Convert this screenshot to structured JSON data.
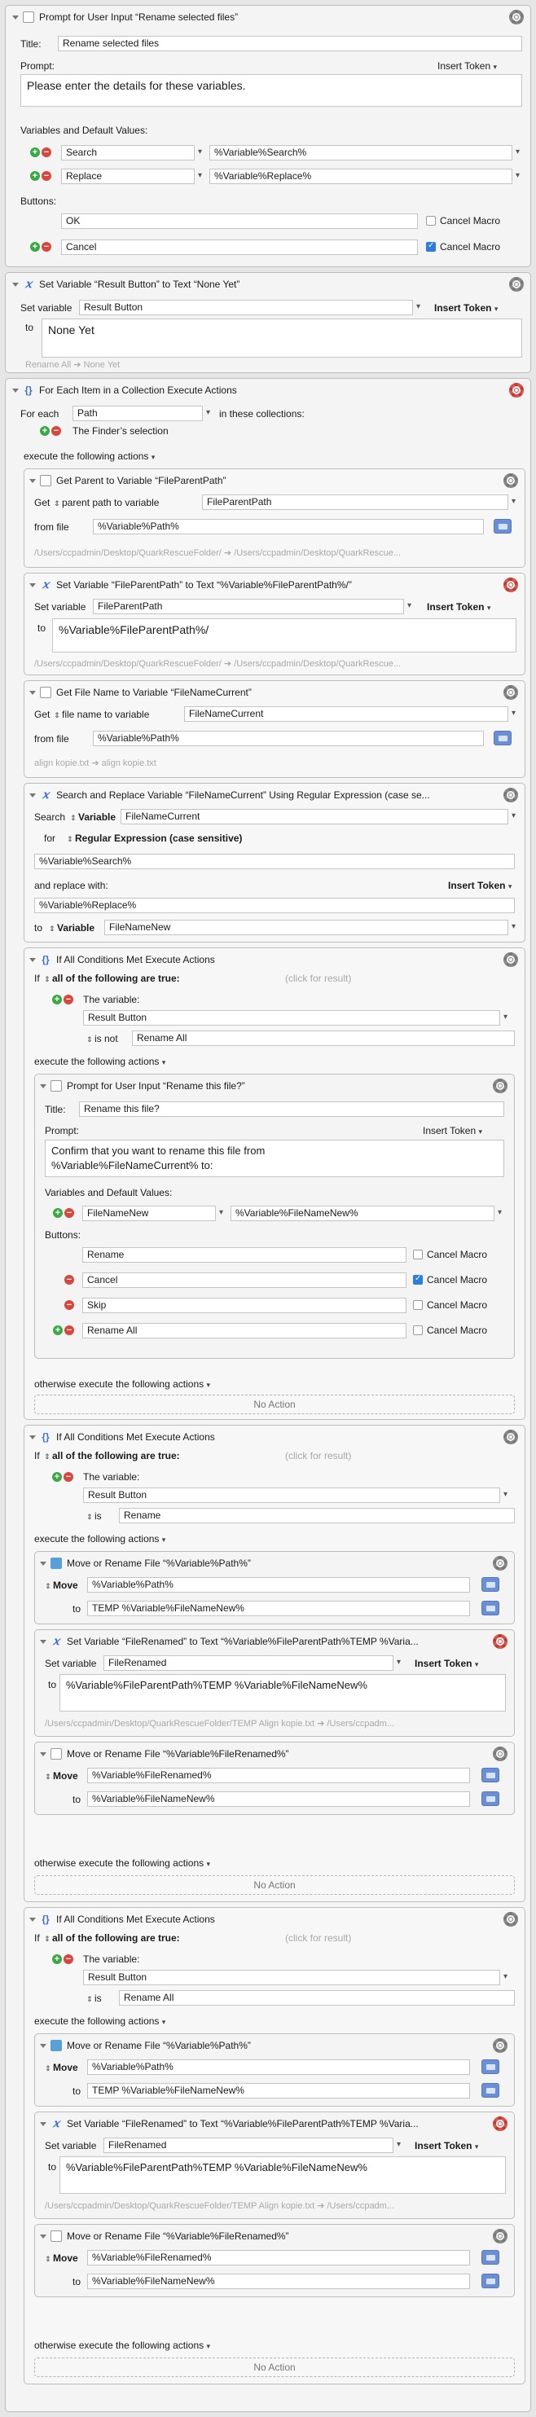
{
  "prompt1": {
    "title": "Prompt for User Input “Rename selected files”",
    "title_label": "Title:",
    "title_value": "Rename selected files",
    "prompt_label": "Prompt:",
    "insert_token": "Insert Token",
    "prompt_text": [
      "Please enter the details for these variables."
    ],
    "vars_label": "Variables and Default Values:",
    "vars": [
      {
        "name": "Search",
        "value": "%Variable%Search%"
      },
      {
        "name": "Replace",
        "value": "%Variable%Replace%"
      }
    ],
    "buttons_label": "Buttons:",
    "buttons": [
      {
        "label": "OK",
        "cancel": false
      },
      {
        "label": "Cancel",
        "cancel": true
      }
    ],
    "cancel_macro": "Cancel Macro"
  },
  "setvar1": {
    "title": "Set Variable “Result Button” to Text “None Yet”",
    "set_variable_label": "Set variable",
    "var_name": "Result Button",
    "insert_token": "Insert Token",
    "to_label": "to",
    "text": "None Yet",
    "path": "Rename All ➔ None Yet"
  },
  "foreach": {
    "title": "For Each Item in a Collection Execute Actions",
    "for_each_label": "For each",
    "for_each_var": "Path",
    "collections_label": "in these collections:",
    "collection": "The Finder’s selection",
    "execute_label": "execute the following actions"
  },
  "getparent": {
    "title": "Get Parent to Variable “FileParentPath”",
    "get_label": "Get",
    "mode": "parent path to variable",
    "var": "FileParentPath",
    "from_label": "from file",
    "from_value": "%Variable%Path%",
    "path": "/Users/ccpadmin/Desktop/QuarkRescueFolder/ ➔ /Users/ccpadmin/Desktop/QuarkRescue..."
  },
  "setvar2": {
    "title": "Set Variable “FileParentPath” to Text “%Variable%FileParentPath%/”",
    "set_variable_label": "Set variable",
    "var_name": "FileParentPath",
    "insert_token": "Insert Token",
    "to_label": "to",
    "text": "%Variable%FileParentPath%/",
    "path": "/Users/ccpadmin/Desktop/QuarkRescueFolder/ ➔ /Users/ccpadmin/Desktop/QuarkRescue..."
  },
  "getname": {
    "title": "Get File Name to Variable “FileNameCurrent”",
    "get_label": "Get",
    "mode": "file name to variable",
    "var": "FileNameCurrent",
    "from_label": "from file",
    "from_value": "%Variable%Path%",
    "path": "align kopie.txt ➔ align kopie.txt"
  },
  "searchreplace": {
    "title": "Search and Replace Variable “FileNameCurrent” Using Regular Expression (case se...",
    "search_label": "Search",
    "variable_label": "Variable",
    "var": "FileNameCurrent",
    "for_label": "for",
    "mode": "Regular Expression (case sensitive)",
    "search_value": "%Variable%Search%",
    "replace_label": "and replace with:",
    "insert_token": "Insert Token",
    "replace_value": "%Variable%Replace%",
    "to_label": "to",
    "to_var_label": "Variable",
    "to_var": "FileNameNew"
  },
  "if1": {
    "title": "If All Conditions Met Execute Actions",
    "if_label": "If",
    "all_label": "all of the following are true:",
    "click_result": "(click for result)",
    "the_variable": "The variable:",
    "var": "Result Button",
    "cond": "is not",
    "cond_value": "Rename All",
    "execute_label": "execute the following actions",
    "otherwise_label": "otherwise execute the following actions",
    "no_action": "No Action"
  },
  "prompt2": {
    "title": "Prompt for User Input “Rename this file?”",
    "title_label": "Title:",
    "title_value": "Rename this file?",
    "prompt_label": "Prompt:",
    "insert_token": "Insert Token",
    "prompt_text": [
      "Confirm that you want to rename this file from",
      "%Variable%FileNameCurrent% to:"
    ],
    "vars_label": "Variables and Default Values:",
    "vars": [
      {
        "name": "FileNameNew",
        "value": "%Variable%FileNameNew%"
      }
    ],
    "buttons_label": "Buttons:",
    "buttons": [
      {
        "label": "Rename",
        "cancel": false
      },
      {
        "label": "Cancel",
        "cancel": true
      },
      {
        "label": "Skip",
        "cancel": false
      },
      {
        "label": "Rename All",
        "cancel": false
      }
    ],
    "cancel_macro": "Cancel Macro"
  },
  "if2": {
    "title": "If All Conditions Met Execute Actions",
    "if_label": "If",
    "all_label": "all of the following are true:",
    "click_result": "(click for result)",
    "the_variable": "The variable:",
    "var": "Result Button",
    "cond": "is",
    "cond_value": "Rename",
    "execute_label": "execute the following actions",
    "otherwise_label": "otherwise execute the following actions",
    "no_action": "No Action",
    "move1": {
      "title": "Move or Rename File “%Variable%Path%”",
      "move_label": "Move",
      "from": "%Variable%Path%",
      "to_label": "to",
      "to": "TEMP %Variable%FileNameNew%"
    },
    "setvar": {
      "title": "Set Variable “FileRenamed” to Text “%Variable%FileParentPath%TEMP %Varia...",
      "set_variable_label": "Set variable",
      "var_name": "FileRenamed",
      "insert_token": "Insert Token",
      "to_label": "to",
      "text": "%Variable%FileParentPath%TEMP %Variable%FileNameNew%",
      "path": "/Users/ccpadmin/Desktop/QuarkRescueFolder/TEMP Align kopie.txt ➔ /Users/ccpadm..."
    },
    "move2": {
      "title": "Move or Rename File “%Variable%FileRenamed%”",
      "move_label": "Move",
      "from": "%Variable%FileRenamed%",
      "to_label": "to",
      "to": "%Variable%FileNameNew%"
    }
  },
  "if3": {
    "title": "If All Conditions Met Execute Actions",
    "if_label": "If",
    "all_label": "all of the following are true:",
    "click_result": "(click for result)",
    "the_variable": "The variable:",
    "var": "Result Button",
    "cond": "is",
    "cond_value": "Rename All",
    "execute_label": "execute the following actions",
    "otherwise_label": "otherwise execute the following actions",
    "no_action": "No Action",
    "move1": {
      "title": "Move or Rename File “%Variable%Path%”",
      "move_label": "Move",
      "from": "%Variable%Path%",
      "to_label": "to",
      "to": "TEMP %Variable%FileNameNew%"
    },
    "setvar": {
      "title": "Set Variable “FileRenamed” to Text “%Variable%FileParentPath%TEMP %Varia...",
      "set_variable_label": "Set variable",
      "var_name": "FileRenamed",
      "insert_token": "Insert Token",
      "to_label": "to",
      "text": "%Variable%FileParentPath%TEMP %Variable%FileNameNew%",
      "path": "/Users/ccpadmin/Desktop/QuarkRescueFolder/TEMP Align kopie.txt ➔ /Users/ccpadm..."
    },
    "move2": {
      "title": "Move or Rename File “%Variable%FileRenamed%”",
      "move_label": "Move",
      "from": "%Variable%FileRenamed%",
      "to_label": "to",
      "to": "%Variable%FileNameNew%"
    }
  },
  "colors": {
    "accent": "#2d7de0",
    "add": "#3aa845",
    "remove": "#d9463d",
    "gear_red": "#d9534f"
  },
  "icons": [
    "gear-icon",
    "add-icon",
    "remove-icon",
    "folder-browse-icon",
    "chevron-down-icon",
    "disclosure-triangle-icon",
    "variable-icon",
    "if-icon",
    "for-each-icon",
    "move-file-icon",
    "prompt-icon"
  ]
}
